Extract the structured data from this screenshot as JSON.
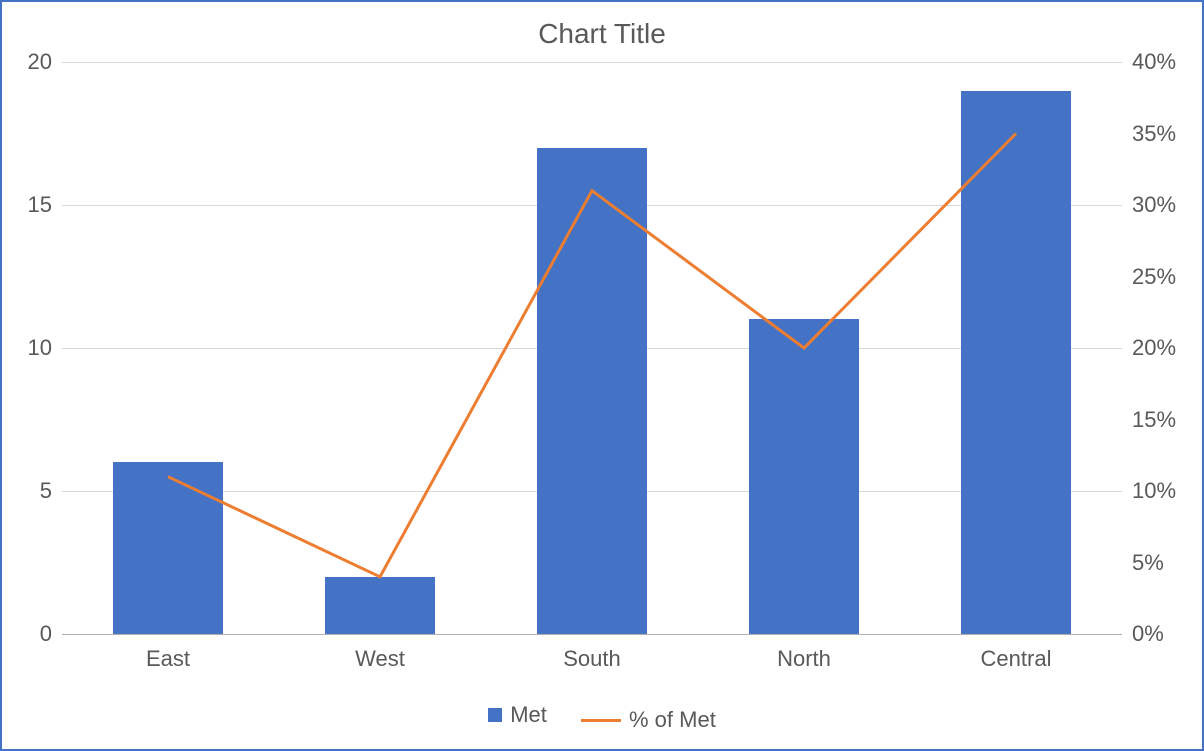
{
  "chart_data": {
    "type": "bar+line",
    "title": "Chart Title",
    "categories": [
      "East",
      "West",
      "South",
      "North",
      "Central"
    ],
    "series": [
      {
        "name": "Met",
        "type": "bar",
        "axis": "left",
        "color": "#4472C4",
        "values": [
          6,
          2,
          17,
          11,
          19
        ]
      },
      {
        "name": "% of Met",
        "type": "line",
        "axis": "right",
        "color": "#ED7D31",
        "values": [
          11,
          4,
          31,
          20,
          35
        ]
      }
    ],
    "y_left": {
      "min": 0,
      "max": 20,
      "step": 5,
      "ticks": [
        0,
        5,
        10,
        15,
        20
      ]
    },
    "y_right": {
      "min": 0,
      "max": 40,
      "step": 5,
      "ticks": [
        0,
        5,
        10,
        15,
        20,
        25,
        30,
        35,
        40
      ],
      "suffix": "%"
    },
    "legend": [
      "Met",
      "% of Met"
    ]
  }
}
